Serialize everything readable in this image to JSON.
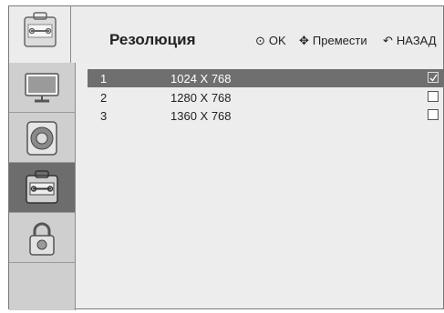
{
  "header": {
    "title": "Резолюция",
    "hints": {
      "ok": "OK",
      "move": "Премести",
      "back": "НАЗАД"
    }
  },
  "sidebar": {
    "items": [
      {
        "icon": "monitor-icon"
      },
      {
        "icon": "speaker-icon"
      },
      {
        "icon": "toolbox-icon",
        "active": true
      },
      {
        "icon": "padlock-icon"
      }
    ]
  },
  "list": {
    "rows": [
      {
        "num": "1",
        "value": "1024 X 768",
        "checked": true,
        "selected": true
      },
      {
        "num": "2",
        "value": "1280 X 768",
        "checked": false,
        "selected": false
      },
      {
        "num": "3",
        "value": "1360 X 768",
        "checked": false,
        "selected": false
      }
    ]
  },
  "colors": {
    "selected_row": "#6f6f6f",
    "sidebar_active": "#6d6d6d",
    "background": "#ededed"
  }
}
